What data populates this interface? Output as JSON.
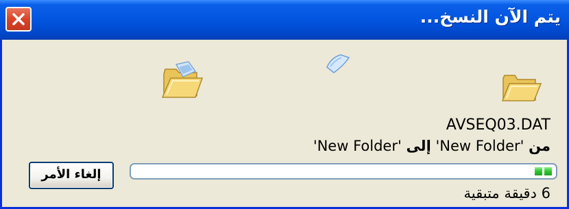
{
  "window": {
    "title": "يتم الآن النسخ...",
    "close_icon": "close-icon"
  },
  "icons": {
    "source_folder": "open-folder-icon",
    "flying_page": "flying-document-icon",
    "destination_folder": "folder-icon"
  },
  "copy": {
    "file_name": "AVSEQ03.DAT",
    "path_from_label": "من",
    "path_source": "'New Folder'",
    "path_to_label": "إلى",
    "path_destination": "'New Folder'"
  },
  "progress": {
    "value_percent": 4
  },
  "buttons": {
    "cancel_label": "إلغاء الأمر"
  },
  "status": {
    "time_remaining": "6 دقيقة متبقية"
  },
  "colors": {
    "titlebar": "#0355E0",
    "window_bg": "#ECE9D8",
    "close_button": "#D9432B",
    "progress_fill": "#2FC42F"
  }
}
